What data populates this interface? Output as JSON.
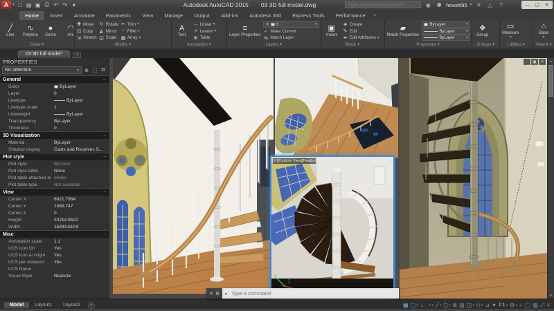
{
  "colors": {
    "accent_red": "#c8382e",
    "selection_blue": "#3f87d2",
    "glass_blue": "#4a69b8",
    "stone_yellow": "#d3c87e",
    "wood_brown": "#b5814b",
    "ui_dark": "#3a3a3a"
  },
  "titlebar": {
    "logo": "A",
    "qat": {
      "new": "□",
      "open": "▤",
      "save": "▣",
      "plot": "⎙",
      "undo": "↶",
      "redo": "↷",
      "menu": "▾"
    },
    "app_title": "Autodesk AutoCAD 2015",
    "doc_title": "03 3D full model.dwg",
    "search_placeholder": "Type a keyword or phrase",
    "search_glyph": "◉",
    "user": "hewett95",
    "a360_glyph": "✕",
    "exchange_glyph": "△",
    "help_glyph": "?",
    "win": {
      "minimize": "—",
      "restore": "▢",
      "close": "✕"
    }
  },
  "ribbon": {
    "tabs": [
      {
        "label": "Home",
        "active": true
      },
      {
        "label": "Insert"
      },
      {
        "label": "Annotate"
      },
      {
        "label": "Parametric"
      },
      {
        "label": "View"
      },
      {
        "label": "Manage"
      },
      {
        "label": "Output"
      },
      {
        "label": "Add-ins"
      },
      {
        "label": "Autodesk 360"
      },
      {
        "label": "Express Tools"
      },
      {
        "label": "Performance"
      }
    ],
    "draw": {
      "label": "Draw",
      "items": [
        {
          "label": "Line",
          "glyph": "╱"
        },
        {
          "label": "Polyline",
          "glyph": "∿"
        },
        {
          "label": "Circle",
          "glyph": "●"
        },
        {
          "label": "Arc",
          "glyph": "◠"
        }
      ]
    },
    "modify": {
      "label": "Modify",
      "items": [
        {
          "label": "Move",
          "glyph": "✚"
        },
        {
          "label": "Copy",
          "glyph": "◫"
        },
        {
          "label": "Stretch",
          "glyph": "⇲"
        },
        {
          "label": "Rotate",
          "glyph": "↻"
        },
        {
          "label": "Mirror",
          "glyph": "◭"
        },
        {
          "label": "Scale",
          "glyph": "◱"
        },
        {
          "label": "Trim",
          "glyph": "✂"
        },
        {
          "label": "Fillet",
          "glyph": "◜"
        },
        {
          "label": "Array",
          "glyph": "▦"
        }
      ]
    },
    "annotation": {
      "label": "Annotation",
      "big": {
        "label": "Text",
        "glyph": "A"
      },
      "items": [
        {
          "label": "Linear",
          "glyph": "↔"
        },
        {
          "label": "Leader",
          "glyph": "↗"
        },
        {
          "label": "Table",
          "glyph": "⊞"
        }
      ]
    },
    "layers": {
      "label": "Layers",
      "big": {
        "label": "Layer Properties",
        "glyph": "≡"
      },
      "layer_value": "0",
      "bulb": "☀",
      "items": [
        {
          "label": "Make Current",
          "glyph": "✓"
        },
        {
          "label": "Match Layer",
          "glyph": "⇆"
        }
      ]
    },
    "block": {
      "label": "Block",
      "big": {
        "label": "Insert",
        "glyph": "▣"
      },
      "items": [
        {
          "label": "Create",
          "glyph": "◈"
        },
        {
          "label": "Edit",
          "glyph": "✎"
        },
        {
          "label": "Edit Attributes",
          "glyph": "✒"
        }
      ]
    },
    "properties": {
      "label": "Properties",
      "big": {
        "label": "Match Properties",
        "glyph": "▰"
      },
      "dropdowns": [
        {
          "value": "ByLayer"
        },
        {
          "value": "ByLayer"
        },
        {
          "value": "ByLayer"
        }
      ]
    },
    "groups": {
      "label": "Groups",
      "big": {
        "label": "Group",
        "glyph": "❖"
      }
    },
    "utilities": {
      "label": "Utilities",
      "big": {
        "label": "Measure",
        "glyph": "▭"
      }
    },
    "view": {
      "label": "View",
      "big": {
        "label": "Base",
        "glyph": "⌂"
      }
    }
  },
  "file_tab": {
    "label": "03 3D full model*",
    "new_button": "+"
  },
  "palette": {
    "title": "PROPERTIES",
    "selector": "No selection",
    "selector_caret": "▾",
    "tool_icons": {
      "pickadd": "⊕",
      "select_objects": "⬚",
      "quick_select": "⧉"
    },
    "collapse_glyph": "−",
    "sections": [
      {
        "title": "General",
        "rows": [
          {
            "label": "Color",
            "value": "ByLayer"
          },
          {
            "label": "Layer",
            "value": "0"
          },
          {
            "label": "Linetype",
            "value": "ByLayer"
          },
          {
            "label": "Linetype scale",
            "value": "1"
          },
          {
            "label": "Lineweight",
            "value": "ByLayer"
          },
          {
            "label": "Transparency",
            "value": "ByLayer"
          },
          {
            "label": "Thickness",
            "value": "0"
          }
        ]
      },
      {
        "title": "3D Visualization",
        "rows": [
          {
            "label": "Material",
            "value": "ByLayer"
          },
          {
            "label": "Shadow display",
            "value": "Casts and Receives S..."
          }
        ]
      },
      {
        "title": "Plot style",
        "rows": [
          {
            "label": "Plot style",
            "value": "ByColor"
          },
          {
            "label": "Plot style table",
            "value": "None"
          },
          {
            "label": "Plot table attached to",
            "value": "Model"
          },
          {
            "label": "Plot table type",
            "value": "Not available"
          }
        ]
      },
      {
        "title": "View",
        "rows": [
          {
            "label": "Center X",
            "value": "6821.7984"
          },
          {
            "label": "Center Y",
            "value": "1069.747"
          },
          {
            "label": "Center Z",
            "value": "0"
          },
          {
            "label": "Height",
            "value": "23214.9522"
          },
          {
            "label": "Width",
            "value": "15343.6104"
          }
        ]
      },
      {
        "title": "Misc",
        "rows": [
          {
            "label": "Annotation scale",
            "value": "1:1"
          },
          {
            "label": "UCS icon On",
            "value": "Yes"
          },
          {
            "label": "UCS icon at origin",
            "value": "Yes"
          },
          {
            "label": "UCS per viewport",
            "value": "Yes"
          },
          {
            "label": "UCS Name",
            "value": ""
          },
          {
            "label": "Visual Style",
            "value": "Realistic"
          }
        ]
      }
    ]
  },
  "viewports": {
    "floating_label": "[-][Custom View][Realistic]",
    "ucs": {
      "x": "X",
      "y": "Y",
      "z": "Z"
    }
  },
  "command_line": {
    "close_glyph": "✕",
    "tools_glyph": "⚙",
    "marker": "▸",
    "prompt_placeholder": "Type a command"
  },
  "statusbar": {
    "model_tab": "Model",
    "layout1_tab": "Layout1",
    "layout2_tab": "Layout2",
    "new_layout": "+",
    "scale": "1:1",
    "icons": [
      {
        "name": "grid",
        "glyph": "▦",
        "on": true
      },
      {
        "name": "snap-mode",
        "glyph": "▢",
        "on": false
      },
      {
        "name": "ortho",
        "glyph": "∟",
        "on": false
      },
      {
        "name": "polar-tracking",
        "glyph": "◔",
        "on": false
      },
      {
        "name": "isodraft",
        "glyph": "╱",
        "on": false
      },
      {
        "name": "object-snap",
        "glyph": "◻",
        "on": true
      },
      {
        "name": "lineweight-display",
        "glyph": "≣",
        "on": false
      },
      {
        "name": "transparency-display",
        "glyph": "▨",
        "on": false
      },
      {
        "name": "selection-cycling",
        "glyph": "◫",
        "on": true
      },
      {
        "name": "object-snap-3d",
        "glyph": "◇",
        "on": true
      },
      {
        "name": "dynamic-ucs",
        "glyph": "⊿",
        "on": false
      },
      {
        "name": "annotation-visibility",
        "glyph": "✦",
        "on": true
      },
      {
        "name": "workspace-gear",
        "glyph": "⚙",
        "on": false
      },
      {
        "name": "customization-plus",
        "glyph": "+",
        "on": false
      },
      {
        "name": "isolate-objects",
        "glyph": "◯",
        "on": false
      },
      {
        "name": "graphics-performance",
        "glyph": "▥",
        "on": true
      },
      {
        "name": "clean-screen",
        "glyph": "⤢",
        "on": false
      },
      {
        "name": "customization-menu",
        "glyph": "≡",
        "on": false
      }
    ]
  }
}
